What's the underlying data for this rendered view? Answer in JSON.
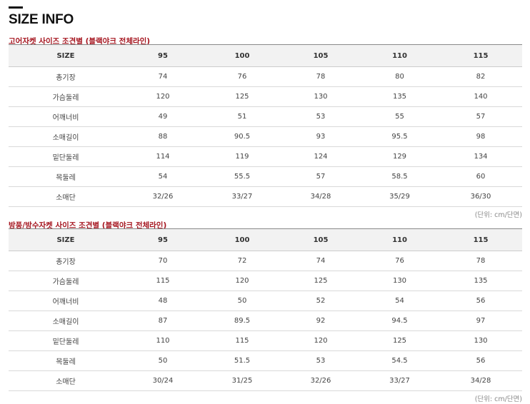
{
  "page_title": "SIZE INFO",
  "tables": [
    {
      "title": "고어자켓 사이즈 조견별 (블랙야크 전체라인)",
      "headers": [
        "SIZE",
        "95",
        "100",
        "105",
        "110",
        "115"
      ],
      "rows": [
        [
          "총기장",
          "74",
          "76",
          "78",
          "80",
          "82"
        ],
        [
          "가슴둘레",
          "120",
          "125",
          "130",
          "135",
          "140"
        ],
        [
          "어깨너비",
          "49",
          "51",
          "53",
          "55",
          "57"
        ],
        [
          "소매길이",
          "88",
          "90.5",
          "93",
          "95.5",
          "98"
        ],
        [
          "밑단둘레",
          "114",
          "119",
          "124",
          "129",
          "134"
        ],
        [
          "목둘레",
          "54",
          "55.5",
          "57",
          "58.5",
          "60"
        ],
        [
          "소매단",
          "32/26",
          "33/27",
          "34/28",
          "35/29",
          "36/30"
        ]
      ],
      "unit_note": "(단위: cm/단면)"
    },
    {
      "title": "방풍/방수자켓 사이즈 조견별 (블랙야크 전체라인)",
      "headers": [
        "SIZE",
        "95",
        "100",
        "105",
        "110",
        "115"
      ],
      "rows": [
        [
          "총기장",
          "70",
          "72",
          "74",
          "76",
          "78"
        ],
        [
          "가슴둘레",
          "115",
          "120",
          "125",
          "130",
          "135"
        ],
        [
          "어깨너비",
          "48",
          "50",
          "52",
          "54",
          "56"
        ],
        [
          "소매길이",
          "87",
          "89.5",
          "92",
          "94.5",
          "97"
        ],
        [
          "밑단둘레",
          "110",
          "115",
          "120",
          "125",
          "130"
        ],
        [
          "목둘레",
          "50",
          "51.5",
          "53",
          "54.5",
          "56"
        ],
        [
          "소매단",
          "30/24",
          "31/25",
          "32/26",
          "33/27",
          "34/28"
        ]
      ],
      "unit_note": "(단위: cm/단면)"
    }
  ],
  "colors": {
    "section_title": "#a5151f",
    "header_bg": "#f2f2f2",
    "row_border": "#d9d9d9"
  }
}
